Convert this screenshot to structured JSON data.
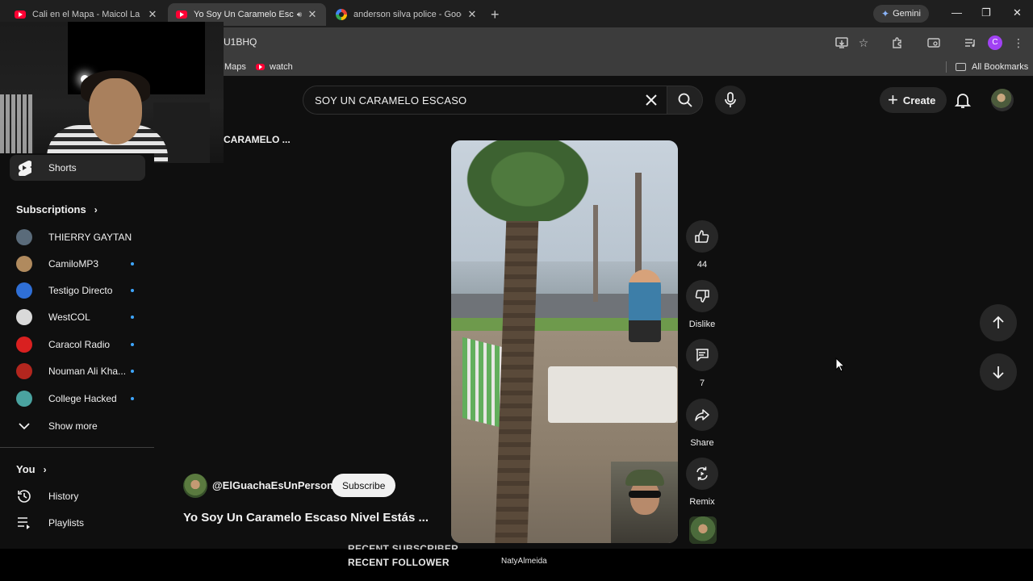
{
  "browser": {
    "tabs": [
      {
        "title": "Cali en el Mapa - Maicol La M",
        "favicon": "youtube-icon",
        "active": false
      },
      {
        "title": "Yo Soy Un Caramelo Escaso",
        "favicon": "youtube-icon",
        "active": true,
        "audio": true
      },
      {
        "title": "anderson silva police - Google",
        "favicon": "google-icon",
        "active": false
      }
    ],
    "gemini_label": "Gemini",
    "url": "U1BHQ",
    "profile_letter": "C",
    "bookmarks": [
      {
        "label": "Maps",
        "icon": "none"
      },
      {
        "label": "watch",
        "icon": "youtube-icon"
      }
    ],
    "all_bookmarks_label": "All Bookmarks"
  },
  "header": {
    "search_query": "SOY UN CARAMELO ESCASO",
    "create_label": "Create"
  },
  "scene_label": "CARAMELO ...",
  "sidebar": {
    "shorts_label": "Shorts",
    "subscriptions_heading": "Subscriptions",
    "subscriptions": [
      {
        "name": "THIERRY GAYTAN",
        "new": false,
        "color": "#5a6b7a"
      },
      {
        "name": "CamiloMP3",
        "new": true,
        "color": "#b08a5e"
      },
      {
        "name": "Testigo Directo",
        "new": true,
        "color": "#2f6fd6"
      },
      {
        "name": "WestCOL",
        "new": true,
        "color": "#d9d9d9"
      },
      {
        "name": "Caracol Radio",
        "new": true,
        "color": "#d92020"
      },
      {
        "name": "Nouman Ali Kha...",
        "new": true,
        "color": "#b3261e"
      },
      {
        "name": "College Hacked",
        "new": true,
        "color": "#4aa3a0"
      }
    ],
    "show_more_label": "Show more",
    "you_heading": "You",
    "you_items": [
      {
        "label": "History",
        "icon": "history-icon"
      },
      {
        "label": "Playlists",
        "icon": "playlists-icon"
      }
    ]
  },
  "short": {
    "likes": "44",
    "dislike_label": "Dislike",
    "comments": "7",
    "share_label": "Share",
    "remix_label": "Remix",
    "channel": "@ElGuachaEsUnPerson",
    "subscribe_label": "Subscribe",
    "title": "Yo Soy Un Caramelo Escaso Nivel Estás ..."
  },
  "stream_overlay": {
    "recent_subscriber_label": "RECENT SUBSCRIBER",
    "recent_follower_label": "RECENT FOLLOWER",
    "recent_follower_name": "NatyAlmeida"
  },
  "colors": {
    "background": "#0f0f0f",
    "surface": "#272727",
    "accent_blue": "#3ea6ff",
    "youtube_red": "#ff0033"
  }
}
